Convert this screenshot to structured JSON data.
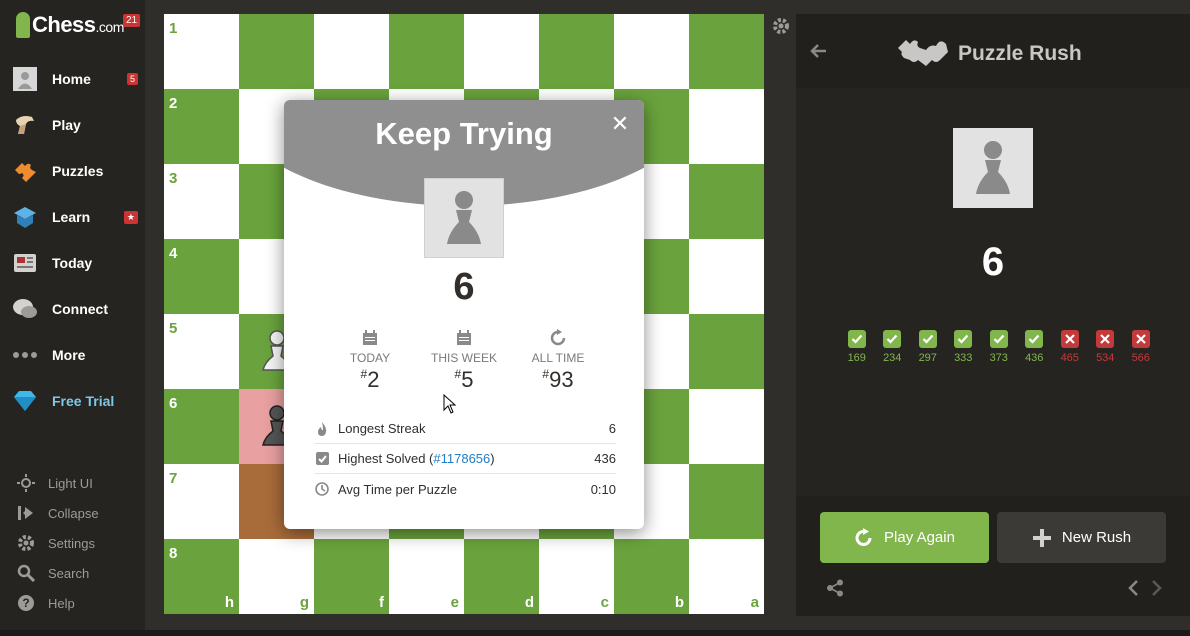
{
  "logo": {
    "name": "Chess",
    "suffix": ".com",
    "badge": "21"
  },
  "nav": [
    {
      "label": "Home",
      "badge": "5",
      "icon": "avatar-icon"
    },
    {
      "label": "Play",
      "badge": "",
      "icon": "play-hand-icon"
    },
    {
      "label": "Puzzles",
      "badge": "",
      "icon": "puzzle-icon"
    },
    {
      "label": "Learn",
      "badge": "★",
      "icon": "learn-icon"
    },
    {
      "label": "Today",
      "badge": "",
      "icon": "news-icon"
    },
    {
      "label": "Connect",
      "badge": "",
      "icon": "chat-icon"
    },
    {
      "label": "More",
      "badge": "",
      "icon": "more-dots-icon"
    },
    {
      "label": "Free Trial",
      "badge": "",
      "icon": "diamond-icon"
    }
  ],
  "bottom_nav": [
    {
      "label": "Light UI",
      "icon": "sun-icon"
    },
    {
      "label": "Collapse",
      "icon": "collapse-icon"
    },
    {
      "label": "Settings",
      "icon": "gear-icon"
    },
    {
      "label": "Search",
      "icon": "search-icon"
    },
    {
      "label": "Help",
      "icon": "help-icon"
    }
  ],
  "board": {
    "ranks": [
      "1",
      "2",
      "3",
      "4",
      "5",
      "6",
      "7",
      "8"
    ],
    "files": [
      "h",
      "g",
      "f",
      "e",
      "d",
      "c",
      "b",
      "a"
    ],
    "colors": {
      "light": "#ffffff",
      "dark": "#6aa33d"
    }
  },
  "modal": {
    "title": "Keep Trying",
    "score": "6",
    "ranks": [
      {
        "label": "TODAY",
        "prefix": "#",
        "value": "2",
        "icon": "calendar-icon"
      },
      {
        "label": "THIS WEEK",
        "prefix": "#",
        "value": "5",
        "icon": "calendar-icon"
      },
      {
        "label": "ALL TIME",
        "prefix": "#",
        "value": "93",
        "icon": "refresh-icon"
      }
    ],
    "stats": {
      "longest_label": "Longest Streak",
      "longest_value": "6",
      "highest_label": "Highest Solved (",
      "highest_link": "#1178656",
      "highest_close": ")",
      "highest_value": "436",
      "avg_label": "Avg Time per Puzzle",
      "avg_value": "0:10"
    }
  },
  "panel": {
    "title": "Puzzle Rush",
    "score": "6",
    "results": [
      {
        "value": "169",
        "ok": true
      },
      {
        "value": "234",
        "ok": true
      },
      {
        "value": "297",
        "ok": true
      },
      {
        "value": "333",
        "ok": true
      },
      {
        "value": "373",
        "ok": true
      },
      {
        "value": "436",
        "ok": true
      },
      {
        "value": "465",
        "ok": false
      },
      {
        "value": "534",
        "ok": false
      },
      {
        "value": "566",
        "ok": false
      }
    ],
    "play_again": "Play Again",
    "new_rush": "New Rush",
    "colors": {
      "accent": "#81b64c",
      "fail": "#c33a3a"
    }
  }
}
